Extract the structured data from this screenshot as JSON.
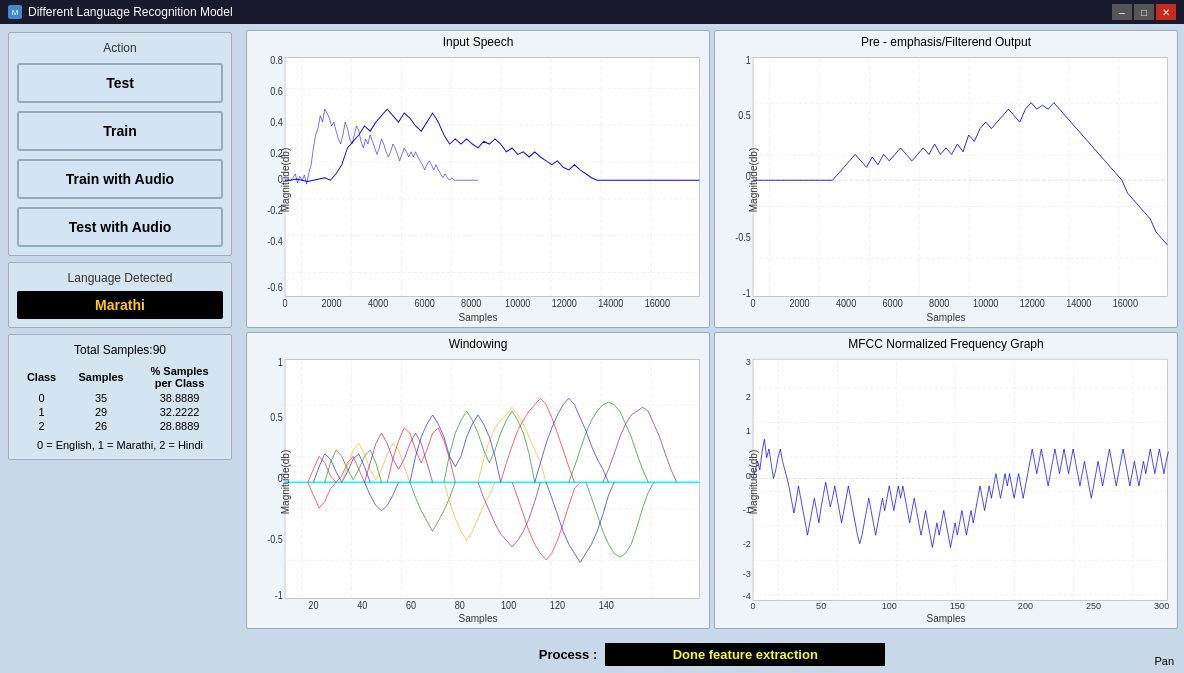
{
  "window": {
    "title": "Different Language Recognition Model",
    "icon": "M"
  },
  "left_panel": {
    "action_group_title": "Action",
    "buttons": [
      {
        "label": "Test",
        "name": "test-button"
      },
      {
        "label": "Train",
        "name": "train-button"
      },
      {
        "label": "Train with Audio",
        "name": "train-with-audio-button"
      },
      {
        "label": "Test with Audio",
        "name": "test-with-audio-button"
      }
    ],
    "language_group_title": "Language Detected",
    "language_value": "Marathi",
    "samples_title": "Total Samples:90",
    "table": {
      "headers": [
        "Class",
        "Samples",
        "% Samples\nper Class"
      ],
      "rows": [
        {
          "class": "0",
          "samples": "35",
          "percent": "38.8889"
        },
        {
          "class": "1",
          "samples": "29",
          "percent": "32.2222"
        },
        {
          "class": "2",
          "samples": "26",
          "percent": "28.8889"
        }
      ]
    },
    "legend": "0 = English, 1 = Marathi, 2 = Hindi"
  },
  "charts": {
    "top_left": {
      "title": "Input Speech",
      "xlabel": "Samples",
      "ylabel": "Magnitude(db)",
      "y_ticks": [
        "0.8",
        "0.6",
        "0.4",
        "0.2",
        "0",
        "-0.2",
        "-0.4",
        "-0.6"
      ],
      "x_ticks": [
        "0",
        "2000",
        "4000",
        "6000",
        "8000",
        "10000",
        "12000",
        "14000",
        "16000"
      ]
    },
    "top_right": {
      "title": "Pre - emphasis/Filterend Output",
      "xlabel": "Samples",
      "ylabel": "Magnitude(db)",
      "y_ticks": [
        "1",
        "0.5",
        "0",
        "-0.5",
        "-1"
      ],
      "x_ticks": [
        "0",
        "2000",
        "4000",
        "6000",
        "8000",
        "10000",
        "12000",
        "14000",
        "16000"
      ]
    },
    "bottom_left": {
      "title": "Windowing",
      "xlabel": "Samples",
      "ylabel": "Magnitude(db)",
      "y_ticks": [
        "1",
        "0.5",
        "0",
        "-0.5",
        "-1"
      ],
      "x_ticks": [
        "20",
        "40",
        "60",
        "80",
        "100",
        "120",
        "140"
      ]
    },
    "bottom_right": {
      "title": "MFCC Normalized Frequency Graph",
      "xlabel": "Samples",
      "ylabel": "Magnitude(db)",
      "y_ticks": [
        "3",
        "2",
        "1",
        "0",
        "-1",
        "-2",
        "-3",
        "-4"
      ],
      "x_ticks": [
        "0",
        "50",
        "100",
        "150",
        "200",
        "250",
        "300"
      ]
    }
  },
  "process_bar": {
    "label": "Process :",
    "value": "Done feature extraction"
  },
  "pan_label": "Pan"
}
